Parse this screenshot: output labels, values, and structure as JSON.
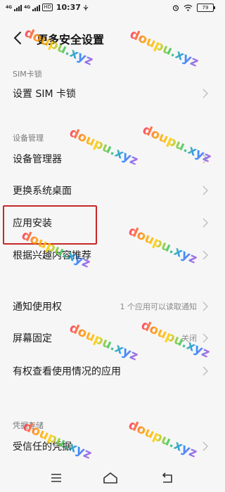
{
  "status_bar": {
    "network_1": "4G",
    "network_2": "4G",
    "hd_badge": "HD",
    "time": "10:37",
    "battery_level": "79"
  },
  "header": {
    "title": "更多安全设置"
  },
  "sections": {
    "sim_lock": {
      "label": "SIM卡锁",
      "items": [
        {
          "label": "设置 SIM 卡锁",
          "value": ""
        }
      ]
    },
    "device_management": {
      "label": "设备管理",
      "items": [
        {
          "label": "设备管理器",
          "value": ""
        },
        {
          "label": "更换系统桌面",
          "value": ""
        },
        {
          "label": "应用安装",
          "value": ""
        },
        {
          "label": "根据兴趣内容推荐",
          "value": ""
        }
      ]
    },
    "other": {
      "items": [
        {
          "label": "通知使用权",
          "value": "1 个应用可以读取通知"
        },
        {
          "label": "屏幕固定",
          "value": "关闭"
        },
        {
          "label": "有权查看使用情况的应用",
          "value": ""
        }
      ]
    },
    "credential_storage": {
      "label": "凭据存储",
      "items": [
        {
          "label": "受信任的凭据",
          "value": ""
        }
      ]
    }
  },
  "watermark": {
    "text": "doupu.xyz"
  },
  "colors": {
    "background": "#f6f6f6",
    "highlight_border": "#c62828"
  },
  "icons": {
    "back": "chevron-left-icon",
    "row_arrow": "chevron-right-icon",
    "nav_menu": "menu-icon",
    "nav_home": "home-icon",
    "nav_back": "back-icon"
  }
}
